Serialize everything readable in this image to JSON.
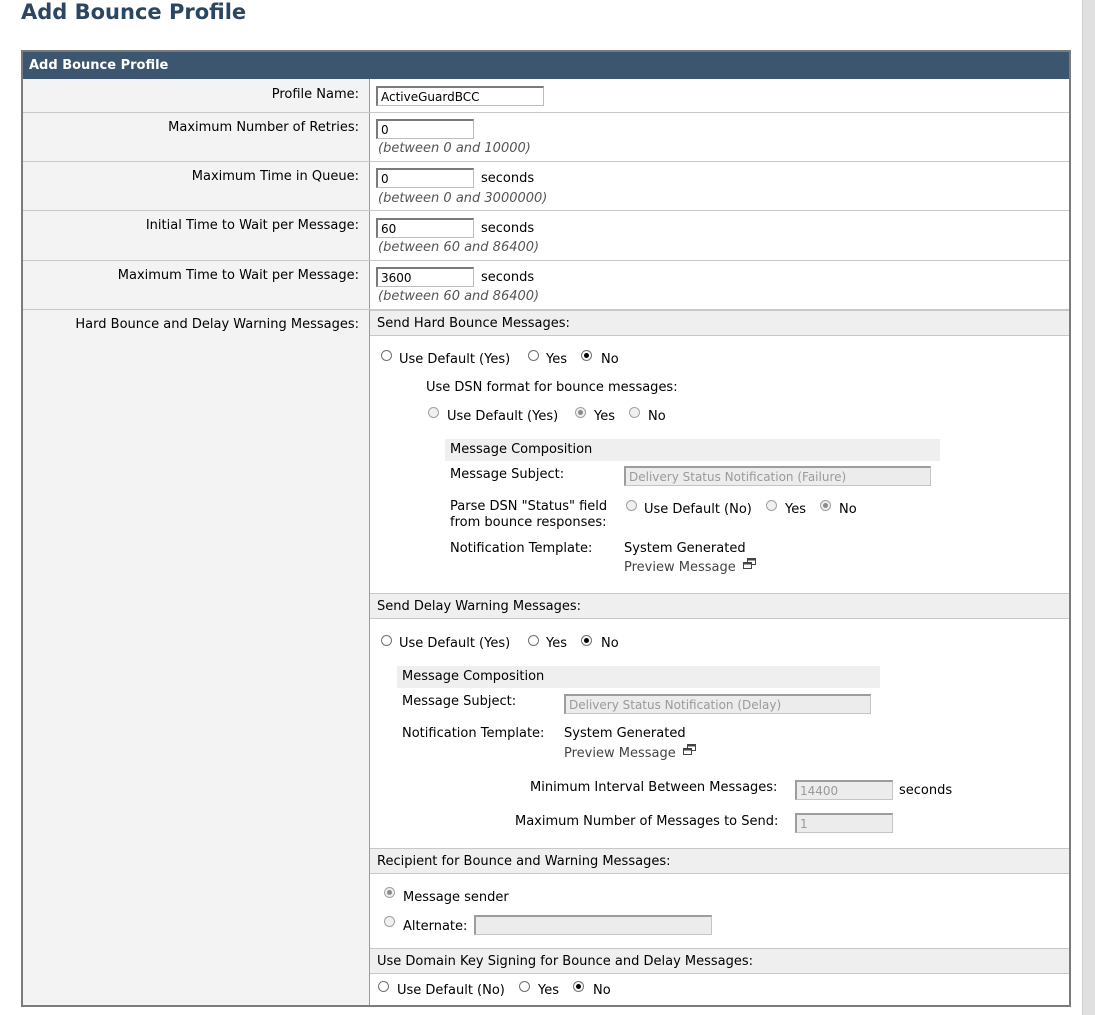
{
  "page": {
    "title": "Add Bounce Profile"
  },
  "panel": {
    "header": "Add Bounce Profile"
  },
  "profile_name": {
    "label": "Profile Name:",
    "value": "ActiveGuardBCC"
  },
  "max_retries": {
    "label": "Maximum Number of Retries:",
    "value": "0",
    "hint": "(between 0 and 10000)"
  },
  "max_time_queue": {
    "label": "Maximum Time in Queue:",
    "value": "0",
    "unit": "seconds",
    "hint": "(between 0 and 3000000)"
  },
  "initial_wait": {
    "label": "Initial Time to Wait per Message:",
    "value": "60",
    "unit": "seconds",
    "hint": "(between 60 and 86400)"
  },
  "max_wait": {
    "label": "Maximum Time to Wait per Message:",
    "value": "3600",
    "unit": "seconds",
    "hint": "(between 60 and 86400)"
  },
  "hard_bounce": {
    "row_label": "Hard Bounce and Delay Warning Messages:",
    "section_title": "Send Hard Bounce Messages:",
    "options": [
      "Use Default (Yes)",
      "Yes",
      "No"
    ],
    "selected": "No",
    "dsn_label": "Use DSN format for bounce messages:",
    "dsn_options": [
      "Use Default (Yes)",
      "Yes",
      "No"
    ],
    "dsn_selected": "Yes",
    "composition_title": "Message Composition",
    "subject_label": "Message Subject:",
    "subject_value": "Delivery Status Notification (Failure)",
    "parse_label_line1": "Parse DSN \"Status\" field",
    "parse_label_line2": "from bounce responses:",
    "parse_options": [
      "Use Default (No)",
      "Yes",
      "No"
    ],
    "parse_selected": "No",
    "template_label": "Notification Template:",
    "template_value": "System Generated",
    "preview_link": "Preview Message"
  },
  "delay_warning": {
    "section_title": "Send Delay Warning Messages:",
    "options": [
      "Use Default (Yes)",
      "Yes",
      "No"
    ],
    "selected": "No",
    "composition_title": "Message Composition",
    "subject_label": "Message Subject:",
    "subject_value": "Delivery Status Notification (Delay)",
    "template_label": "Notification Template:",
    "template_value": "System Generated",
    "preview_link": "Preview Message",
    "min_interval_label": "Minimum Interval Between Messages:",
    "min_interval_value": "14400",
    "min_interval_unit": "seconds",
    "max_messages_label": "Maximum Number of Messages to Send:",
    "max_messages_value": "1"
  },
  "recipient": {
    "section_title": "Recipient for Bounce and Warning Messages:",
    "sender_label": "Message sender",
    "alternate_label": "Alternate:",
    "alternate_value": "",
    "selected": "Message sender"
  },
  "domain_key": {
    "section_title": "Use Domain Key Signing for Bounce and Delay Messages:",
    "options": [
      "Use Default (No)",
      "Yes",
      "No"
    ],
    "selected": "No"
  }
}
